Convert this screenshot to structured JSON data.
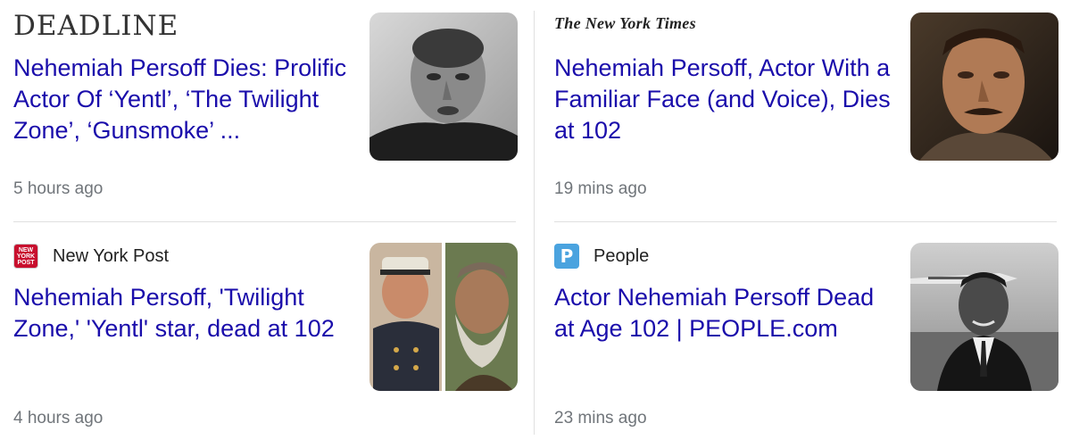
{
  "articles": [
    {
      "source": "DEADLINE",
      "headline": "Nehemiah Persoff Dies: Prolific Actor Of ‘Yentl’, ‘The Twilight Zone’, ‘Gunsmoke’ ...",
      "time": "5 hours ago"
    },
    {
      "source": "The New York Times",
      "headline": "Nehemiah Persoff, Actor With a Familiar Face (and Voice), Dies at 102",
      "time": "19 mins ago"
    },
    {
      "source": "New York Post",
      "favicon_text": "NEW YORK POST",
      "headline": "Nehemiah Persoff, 'Twilight Zone,' 'Yentl' star, dead at 102",
      "time": "4 hours ago"
    },
    {
      "source": "People",
      "favicon_text": "P",
      "headline": "Actor Nehemiah Persoff Dead at Age 102 | PEOPLE.com",
      "time": "23 mins ago"
    }
  ],
  "colors": {
    "headline": "#1a0dab",
    "meta": "#70757a",
    "nypost": "#c8102e",
    "people": "#4aa3df"
  }
}
